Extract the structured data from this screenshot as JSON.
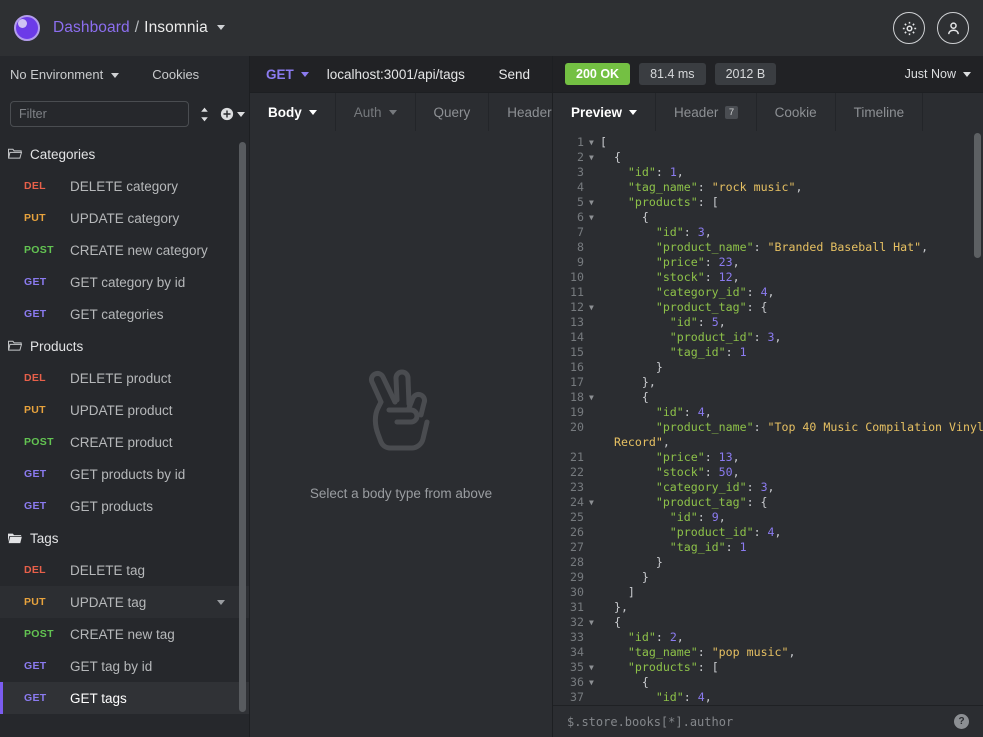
{
  "header": {
    "breadcrumb_root": "Dashboard",
    "breadcrumb_sep": "/",
    "breadcrumb_current": "Insomnia",
    "logo_icon": "insomnia-logo-icon",
    "settings_icon": "gear-icon",
    "account_icon": "user-avatar-icon",
    "accent_color": "#7b5cf0"
  },
  "sidebar": {
    "environment_label": "No Environment",
    "cookies_label": "Cookies",
    "filter_placeholder": "Filter",
    "sort_icon": "sort-updown-icon",
    "add_icon": "plus-circle-icon",
    "groups": [
      {
        "name": "Categories",
        "icon": "folder-open-icon",
        "items": [
          {
            "method": "DEL",
            "label": "DELETE category"
          },
          {
            "method": "PUT",
            "label": "UPDATE category"
          },
          {
            "method": "POST",
            "label": "CREATE new category"
          },
          {
            "method": "GET",
            "label": "GET category by id"
          },
          {
            "method": "GET",
            "label": "GET categories"
          }
        ]
      },
      {
        "name": "Products",
        "icon": "folder-open-icon",
        "items": [
          {
            "method": "DEL",
            "label": "DELETE product"
          },
          {
            "method": "PUT",
            "label": "UPDATE product"
          },
          {
            "method": "POST",
            "label": "CREATE product"
          },
          {
            "method": "GET",
            "label": "GET products by id"
          },
          {
            "method": "GET",
            "label": "GET products"
          }
        ]
      },
      {
        "name": "Tags",
        "icon": "folder-open-filled-icon",
        "items": [
          {
            "method": "DEL",
            "label": "DELETE tag"
          },
          {
            "method": "PUT",
            "label": "UPDATE tag",
            "hovered": true,
            "caret": true
          },
          {
            "method": "POST",
            "label": "CREATE new tag"
          },
          {
            "method": "GET",
            "label": "GET tag by id"
          },
          {
            "method": "GET",
            "label": "GET tags",
            "active": true
          }
        ]
      }
    ],
    "method_colors": {
      "DEL": "#e8604a",
      "PUT": "#e8a33d",
      "POST": "#63c452",
      "GET": "#8b7bf0"
    }
  },
  "request": {
    "method": "GET",
    "url": "localhost:3001/api/tags",
    "send_label": "Send",
    "tabs": [
      {
        "label": "Body",
        "selected": true,
        "caret": true
      },
      {
        "label": "Auth",
        "selected": false,
        "caret": true,
        "dim": true
      },
      {
        "label": "Query",
        "selected": false
      },
      {
        "label": "Header",
        "selected": false
      }
    ],
    "empty_icon": "peace-hand-icon",
    "empty_text": "Select a body type from above"
  },
  "response": {
    "status": "200 OK",
    "time": "81.4 ms",
    "size": "2012 B",
    "timestamp_label": "Just Now",
    "status_color": "#74c043",
    "tabs": [
      {
        "label": "Preview",
        "selected": true,
        "caret": true
      },
      {
        "label": "Header",
        "selected": false,
        "badge": "7"
      },
      {
        "label": "Cookie",
        "selected": false
      },
      {
        "label": "Timeline",
        "selected": false
      }
    ],
    "filter_placeholder": "$.store.books[*].author",
    "help_icon": "question-mark-icon",
    "code_lines": [
      {
        "no": 1,
        "fold": true,
        "tokens": [
          {
            "t": "p",
            "v": "["
          }
        ]
      },
      {
        "no": 2,
        "fold": true,
        "tokens": [
          {
            "t": "p",
            "v": "  {"
          }
        ]
      },
      {
        "no": 3,
        "fold": false,
        "tokens": [
          {
            "t": "k",
            "v": "    \"id\""
          },
          {
            "t": "p",
            "v": ": "
          },
          {
            "t": "n",
            "v": "1"
          },
          {
            "t": "p",
            "v": ","
          }
        ]
      },
      {
        "no": 4,
        "fold": false,
        "tokens": [
          {
            "t": "k",
            "v": "    \"tag_name\""
          },
          {
            "t": "p",
            "v": ": "
          },
          {
            "t": "s",
            "v": "\"rock music\""
          },
          {
            "t": "p",
            "v": ","
          }
        ]
      },
      {
        "no": 5,
        "fold": true,
        "tokens": [
          {
            "t": "k",
            "v": "    \"products\""
          },
          {
            "t": "p",
            "v": ": ["
          }
        ]
      },
      {
        "no": 6,
        "fold": true,
        "tokens": [
          {
            "t": "p",
            "v": "      {"
          }
        ]
      },
      {
        "no": 7,
        "fold": false,
        "tokens": [
          {
            "t": "k",
            "v": "        \"id\""
          },
          {
            "t": "p",
            "v": ": "
          },
          {
            "t": "n",
            "v": "3"
          },
          {
            "t": "p",
            "v": ","
          }
        ]
      },
      {
        "no": 8,
        "fold": false,
        "tokens": [
          {
            "t": "k",
            "v": "        \"product_name\""
          },
          {
            "t": "p",
            "v": ": "
          },
          {
            "t": "s",
            "v": "\"Branded Baseball Hat\""
          },
          {
            "t": "p",
            "v": ","
          }
        ]
      },
      {
        "no": 9,
        "fold": false,
        "tokens": [
          {
            "t": "k",
            "v": "        \"price\""
          },
          {
            "t": "p",
            "v": ": "
          },
          {
            "t": "n",
            "v": "23"
          },
          {
            "t": "p",
            "v": ","
          }
        ]
      },
      {
        "no": 10,
        "fold": false,
        "tokens": [
          {
            "t": "k",
            "v": "        \"stock\""
          },
          {
            "t": "p",
            "v": ": "
          },
          {
            "t": "n",
            "v": "12"
          },
          {
            "t": "p",
            "v": ","
          }
        ]
      },
      {
        "no": 11,
        "fold": false,
        "tokens": [
          {
            "t": "k",
            "v": "        \"category_id\""
          },
          {
            "t": "p",
            "v": ": "
          },
          {
            "t": "n",
            "v": "4"
          },
          {
            "t": "p",
            "v": ","
          }
        ]
      },
      {
        "no": 12,
        "fold": true,
        "tokens": [
          {
            "t": "k",
            "v": "        \"product_tag\""
          },
          {
            "t": "p",
            "v": ": {"
          }
        ]
      },
      {
        "no": 13,
        "fold": false,
        "tokens": [
          {
            "t": "k",
            "v": "          \"id\""
          },
          {
            "t": "p",
            "v": ": "
          },
          {
            "t": "n",
            "v": "5"
          },
          {
            "t": "p",
            "v": ","
          }
        ]
      },
      {
        "no": 14,
        "fold": false,
        "tokens": [
          {
            "t": "k",
            "v": "          \"product_id\""
          },
          {
            "t": "p",
            "v": ": "
          },
          {
            "t": "n",
            "v": "3"
          },
          {
            "t": "p",
            "v": ","
          }
        ]
      },
      {
        "no": 15,
        "fold": false,
        "tokens": [
          {
            "t": "k",
            "v": "          \"tag_id\""
          },
          {
            "t": "p",
            "v": ": "
          },
          {
            "t": "n",
            "v": "1"
          }
        ]
      },
      {
        "no": 16,
        "fold": false,
        "tokens": [
          {
            "t": "p",
            "v": "        }"
          }
        ]
      },
      {
        "no": 17,
        "fold": false,
        "tokens": [
          {
            "t": "p",
            "v": "      },"
          }
        ]
      },
      {
        "no": 18,
        "fold": true,
        "tokens": [
          {
            "t": "p",
            "v": "      {"
          }
        ]
      },
      {
        "no": 19,
        "fold": false,
        "tokens": [
          {
            "t": "k",
            "v": "        \"id\""
          },
          {
            "t": "p",
            "v": ": "
          },
          {
            "t": "n",
            "v": "4"
          },
          {
            "t": "p",
            "v": ","
          }
        ]
      },
      {
        "no": 20,
        "fold": false,
        "wrap": true,
        "tokens": [
          {
            "t": "k",
            "v": "        \"product_name\""
          },
          {
            "t": "p",
            "v": ": "
          },
          {
            "t": "s",
            "v": "\"Top 40 Music Compilation Vinyl"
          }
        ]
      },
      {
        "no": "",
        "fold": false,
        "cont": true,
        "tokens": [
          {
            "t": "s",
            "v": "  Record\""
          },
          {
            "t": "p",
            "v": ","
          }
        ]
      },
      {
        "no": 21,
        "fold": false,
        "tokens": [
          {
            "t": "k",
            "v": "        \"price\""
          },
          {
            "t": "p",
            "v": ": "
          },
          {
            "t": "n",
            "v": "13"
          },
          {
            "t": "p",
            "v": ","
          }
        ]
      },
      {
        "no": 22,
        "fold": false,
        "tokens": [
          {
            "t": "k",
            "v": "        \"stock\""
          },
          {
            "t": "p",
            "v": ": "
          },
          {
            "t": "n",
            "v": "50"
          },
          {
            "t": "p",
            "v": ","
          }
        ]
      },
      {
        "no": 23,
        "fold": false,
        "tokens": [
          {
            "t": "k",
            "v": "        \"category_id\""
          },
          {
            "t": "p",
            "v": ": "
          },
          {
            "t": "n",
            "v": "3"
          },
          {
            "t": "p",
            "v": ","
          }
        ]
      },
      {
        "no": 24,
        "fold": true,
        "tokens": [
          {
            "t": "k",
            "v": "        \"product_tag\""
          },
          {
            "t": "p",
            "v": ": {"
          }
        ]
      },
      {
        "no": 25,
        "fold": false,
        "tokens": [
          {
            "t": "k",
            "v": "          \"id\""
          },
          {
            "t": "p",
            "v": ": "
          },
          {
            "t": "n",
            "v": "9"
          },
          {
            "t": "p",
            "v": ","
          }
        ]
      },
      {
        "no": 26,
        "fold": false,
        "tokens": [
          {
            "t": "k",
            "v": "          \"product_id\""
          },
          {
            "t": "p",
            "v": ": "
          },
          {
            "t": "n",
            "v": "4"
          },
          {
            "t": "p",
            "v": ","
          }
        ]
      },
      {
        "no": 27,
        "fold": false,
        "tokens": [
          {
            "t": "k",
            "v": "          \"tag_id\""
          },
          {
            "t": "p",
            "v": ": "
          },
          {
            "t": "n",
            "v": "1"
          }
        ]
      },
      {
        "no": 28,
        "fold": false,
        "tokens": [
          {
            "t": "p",
            "v": "        }"
          }
        ]
      },
      {
        "no": 29,
        "fold": false,
        "tokens": [
          {
            "t": "p",
            "v": "      }"
          }
        ]
      },
      {
        "no": 30,
        "fold": false,
        "tokens": [
          {
            "t": "p",
            "v": "    ]"
          }
        ]
      },
      {
        "no": 31,
        "fold": false,
        "tokens": [
          {
            "t": "p",
            "v": "  },"
          }
        ]
      },
      {
        "no": 32,
        "fold": true,
        "tokens": [
          {
            "t": "p",
            "v": "  {"
          }
        ]
      },
      {
        "no": 33,
        "fold": false,
        "tokens": [
          {
            "t": "k",
            "v": "    \"id\""
          },
          {
            "t": "p",
            "v": ": "
          },
          {
            "t": "n",
            "v": "2"
          },
          {
            "t": "p",
            "v": ","
          }
        ]
      },
      {
        "no": 34,
        "fold": false,
        "tokens": [
          {
            "t": "k",
            "v": "    \"tag_name\""
          },
          {
            "t": "p",
            "v": ": "
          },
          {
            "t": "s",
            "v": "\"pop music\""
          },
          {
            "t": "p",
            "v": ","
          }
        ]
      },
      {
        "no": 35,
        "fold": true,
        "tokens": [
          {
            "t": "k",
            "v": "    \"products\""
          },
          {
            "t": "p",
            "v": ": ["
          }
        ]
      },
      {
        "no": 36,
        "fold": true,
        "tokens": [
          {
            "t": "p",
            "v": "      {"
          }
        ]
      },
      {
        "no": 37,
        "fold": false,
        "tokens": [
          {
            "t": "k",
            "v": "        \"id\""
          },
          {
            "t": "p",
            "v": ": "
          },
          {
            "t": "n",
            "v": "4"
          },
          {
            "t": "p",
            "v": ","
          }
        ]
      }
    ]
  }
}
